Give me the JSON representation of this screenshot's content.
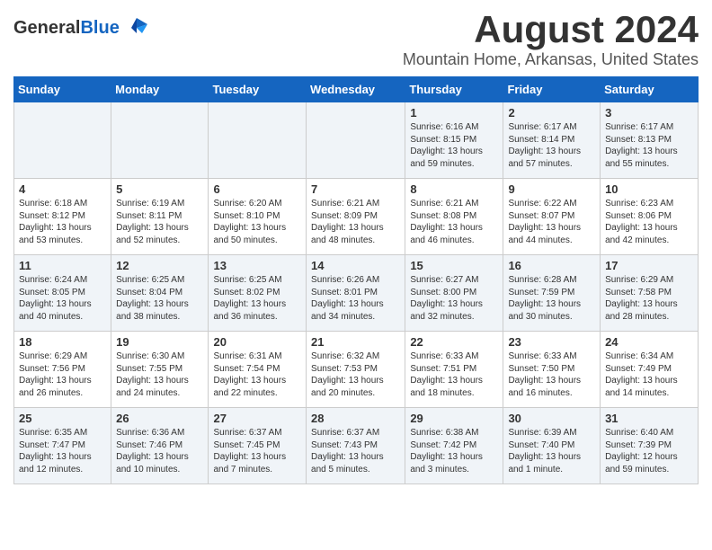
{
  "header": {
    "logo_general": "General",
    "logo_blue": "Blue",
    "month_title": "August 2024",
    "location": "Mountain Home, Arkansas, United States"
  },
  "days_of_week": [
    "Sunday",
    "Monday",
    "Tuesday",
    "Wednesday",
    "Thursday",
    "Friday",
    "Saturday"
  ],
  "weeks": [
    [
      {
        "day": "",
        "content": ""
      },
      {
        "day": "",
        "content": ""
      },
      {
        "day": "",
        "content": ""
      },
      {
        "day": "",
        "content": ""
      },
      {
        "day": "1",
        "content": "Sunrise: 6:16 AM\nSunset: 8:15 PM\nDaylight: 13 hours\nand 59 minutes."
      },
      {
        "day": "2",
        "content": "Sunrise: 6:17 AM\nSunset: 8:14 PM\nDaylight: 13 hours\nand 57 minutes."
      },
      {
        "day": "3",
        "content": "Sunrise: 6:17 AM\nSunset: 8:13 PM\nDaylight: 13 hours\nand 55 minutes."
      }
    ],
    [
      {
        "day": "4",
        "content": "Sunrise: 6:18 AM\nSunset: 8:12 PM\nDaylight: 13 hours\nand 53 minutes."
      },
      {
        "day": "5",
        "content": "Sunrise: 6:19 AM\nSunset: 8:11 PM\nDaylight: 13 hours\nand 52 minutes."
      },
      {
        "day": "6",
        "content": "Sunrise: 6:20 AM\nSunset: 8:10 PM\nDaylight: 13 hours\nand 50 minutes."
      },
      {
        "day": "7",
        "content": "Sunrise: 6:21 AM\nSunset: 8:09 PM\nDaylight: 13 hours\nand 48 minutes."
      },
      {
        "day": "8",
        "content": "Sunrise: 6:21 AM\nSunset: 8:08 PM\nDaylight: 13 hours\nand 46 minutes."
      },
      {
        "day": "9",
        "content": "Sunrise: 6:22 AM\nSunset: 8:07 PM\nDaylight: 13 hours\nand 44 minutes."
      },
      {
        "day": "10",
        "content": "Sunrise: 6:23 AM\nSunset: 8:06 PM\nDaylight: 13 hours\nand 42 minutes."
      }
    ],
    [
      {
        "day": "11",
        "content": "Sunrise: 6:24 AM\nSunset: 8:05 PM\nDaylight: 13 hours\nand 40 minutes."
      },
      {
        "day": "12",
        "content": "Sunrise: 6:25 AM\nSunset: 8:04 PM\nDaylight: 13 hours\nand 38 minutes."
      },
      {
        "day": "13",
        "content": "Sunrise: 6:25 AM\nSunset: 8:02 PM\nDaylight: 13 hours\nand 36 minutes."
      },
      {
        "day": "14",
        "content": "Sunrise: 6:26 AM\nSunset: 8:01 PM\nDaylight: 13 hours\nand 34 minutes."
      },
      {
        "day": "15",
        "content": "Sunrise: 6:27 AM\nSunset: 8:00 PM\nDaylight: 13 hours\nand 32 minutes."
      },
      {
        "day": "16",
        "content": "Sunrise: 6:28 AM\nSunset: 7:59 PM\nDaylight: 13 hours\nand 30 minutes."
      },
      {
        "day": "17",
        "content": "Sunrise: 6:29 AM\nSunset: 7:58 PM\nDaylight: 13 hours\nand 28 minutes."
      }
    ],
    [
      {
        "day": "18",
        "content": "Sunrise: 6:29 AM\nSunset: 7:56 PM\nDaylight: 13 hours\nand 26 minutes."
      },
      {
        "day": "19",
        "content": "Sunrise: 6:30 AM\nSunset: 7:55 PM\nDaylight: 13 hours\nand 24 minutes."
      },
      {
        "day": "20",
        "content": "Sunrise: 6:31 AM\nSunset: 7:54 PM\nDaylight: 13 hours\nand 22 minutes."
      },
      {
        "day": "21",
        "content": "Sunrise: 6:32 AM\nSunset: 7:53 PM\nDaylight: 13 hours\nand 20 minutes."
      },
      {
        "day": "22",
        "content": "Sunrise: 6:33 AM\nSunset: 7:51 PM\nDaylight: 13 hours\nand 18 minutes."
      },
      {
        "day": "23",
        "content": "Sunrise: 6:33 AM\nSunset: 7:50 PM\nDaylight: 13 hours\nand 16 minutes."
      },
      {
        "day": "24",
        "content": "Sunrise: 6:34 AM\nSunset: 7:49 PM\nDaylight: 13 hours\nand 14 minutes."
      }
    ],
    [
      {
        "day": "25",
        "content": "Sunrise: 6:35 AM\nSunset: 7:47 PM\nDaylight: 13 hours\nand 12 minutes."
      },
      {
        "day": "26",
        "content": "Sunrise: 6:36 AM\nSunset: 7:46 PM\nDaylight: 13 hours\nand 10 minutes."
      },
      {
        "day": "27",
        "content": "Sunrise: 6:37 AM\nSunset: 7:45 PM\nDaylight: 13 hours\nand 7 minutes."
      },
      {
        "day": "28",
        "content": "Sunrise: 6:37 AM\nSunset: 7:43 PM\nDaylight: 13 hours\nand 5 minutes."
      },
      {
        "day": "29",
        "content": "Sunrise: 6:38 AM\nSunset: 7:42 PM\nDaylight: 13 hours\nand 3 minutes."
      },
      {
        "day": "30",
        "content": "Sunrise: 6:39 AM\nSunset: 7:40 PM\nDaylight: 13 hours\nand 1 minute."
      },
      {
        "day": "31",
        "content": "Sunrise: 6:40 AM\nSunset: 7:39 PM\nDaylight: 12 hours\nand 59 minutes."
      }
    ]
  ]
}
